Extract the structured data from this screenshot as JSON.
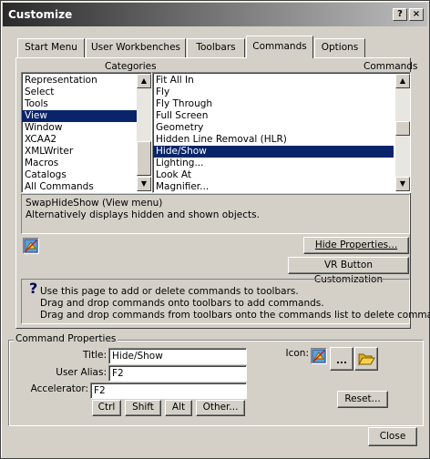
{
  "window": {
    "title": "Customize",
    "help_glyph": "?",
    "close_glyph": "×"
  },
  "tabs": [
    {
      "label": "Start Menu"
    },
    {
      "label": "User Workbenches"
    },
    {
      "label": "Toolbars"
    },
    {
      "label": "Commands"
    },
    {
      "label": "Options"
    }
  ],
  "categories": {
    "header": "Categories",
    "items": [
      "Representation",
      "Select",
      "Tools",
      "View",
      "Window",
      "XCAA2",
      "XMLWriter",
      "Macros",
      "Catalogs",
      "All Commands"
    ],
    "selected": "View"
  },
  "commands": {
    "header": "Commands",
    "items": [
      "Fit All In",
      "Fly",
      "Fly Through",
      "Full Screen",
      "Geometry",
      "Hidden Line Removal (HLR)",
      "Hide/Show",
      "Lighting...",
      "Look At",
      "Magnifier..."
    ],
    "selected": "Hide/Show"
  },
  "description": {
    "line1": "SwapHideShow (View menu)",
    "line2": "Alternatively displays hidden and shown objects."
  },
  "buttons": {
    "hide_properties": "Hide Properties...",
    "vr_customization": "VR Button Customization",
    "ctrl": "Ctrl",
    "shift": "Shift",
    "alt": "Alt",
    "other": "Other...",
    "reset": "Reset...",
    "close": "Close",
    "icon_browse": "...",
    "help_glyph": "?"
  },
  "help": {
    "line1": "Use this page to add or delete commands to toolbars.",
    "line2": "Drag and drop commands onto toolbars to add commands.",
    "line3": "Drag and drop commands from toolbars onto the commands list to delete command."
  },
  "command_properties": {
    "group_label": "Command Properties",
    "title_label": "Title:",
    "title_value": "Hide/Show",
    "alias_label": "User Alias:",
    "alias_value": "F2",
    "accel_label": "Accelerator:",
    "accel_value": "F2",
    "icon_label": "Icon:"
  }
}
